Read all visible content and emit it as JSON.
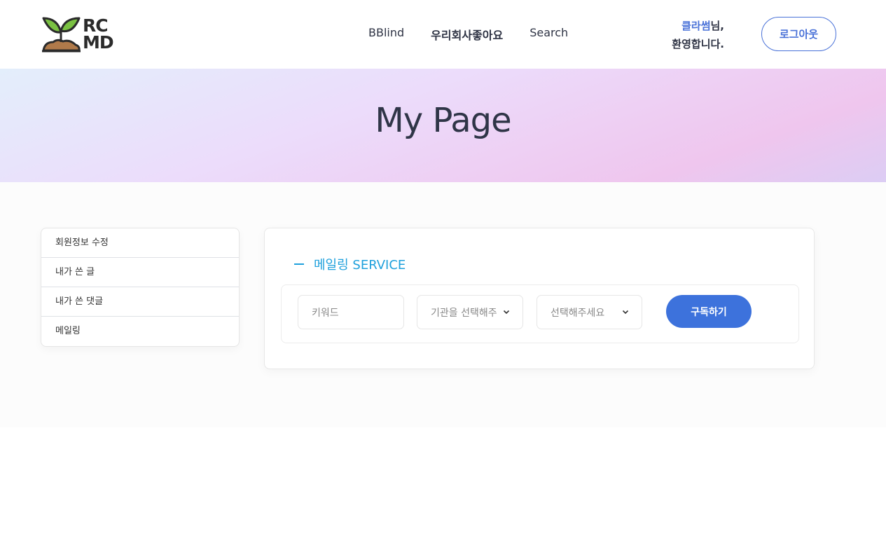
{
  "header": {
    "logo_text_top": "RC",
    "logo_text_bottom": "MD",
    "nav": [
      {
        "label": "BBlind"
      },
      {
        "label": "우리회사좋아요"
      },
      {
        "label": "Search"
      }
    ],
    "welcome_user": "클라썸",
    "welcome_suffix": "님,",
    "welcome_line2": "환영합니다.",
    "logout_label": "로그아웃"
  },
  "hero": {
    "title": "My Page"
  },
  "sidebar": {
    "items": [
      {
        "label": "회원정보 수정"
      },
      {
        "label": "내가 쓴 글"
      },
      {
        "label": "내가 쓴 댓글"
      },
      {
        "label": "메일링"
      }
    ]
  },
  "mailing": {
    "title": "메일링 SERVICE",
    "keyword_placeholder": "키워드",
    "institution_select": "기관을 선택해주",
    "category_select": "선택해주세요",
    "subscribe_label": "구독하기"
  },
  "colors": {
    "accent_blue": "#3d72dc",
    "section_title": "#1ea0dc",
    "text_dark": "#2e3344"
  }
}
